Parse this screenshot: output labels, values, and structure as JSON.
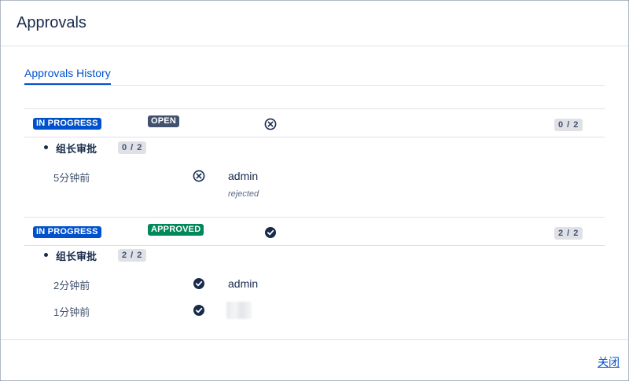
{
  "dialog": {
    "title": "Approvals",
    "tab_label": "Approvals History",
    "close_label": "关闭"
  },
  "approvals": [
    {
      "status": "IN PROGRESS",
      "decision": "OPEN",
      "decision_icon": "circle-x-icon",
      "count": "0 / 2",
      "step": {
        "name": "组长审批",
        "count": "0 / 2"
      },
      "entries": [
        {
          "time": "5分钟前",
          "icon": "circle-x-icon",
          "user": "admin",
          "comment": "rejected"
        }
      ]
    },
    {
      "status": "IN PROGRESS",
      "decision": "APPROVED",
      "decision_icon": "check-circle-icon",
      "count": "2 / 2",
      "step": {
        "name": "组长审批",
        "count": "2 / 2"
      },
      "entries": [
        {
          "time": "2分钟前",
          "icon": "check-circle-icon",
          "user": "admin"
        },
        {
          "time": "1分钟前",
          "icon": "check-circle-icon",
          "user": ""
        }
      ]
    }
  ],
  "colors": {
    "blue_lozenge": "#0052cc",
    "open_lozenge": "#42526e",
    "approved_lozenge": "#00875a",
    "link": "#0052cc"
  }
}
